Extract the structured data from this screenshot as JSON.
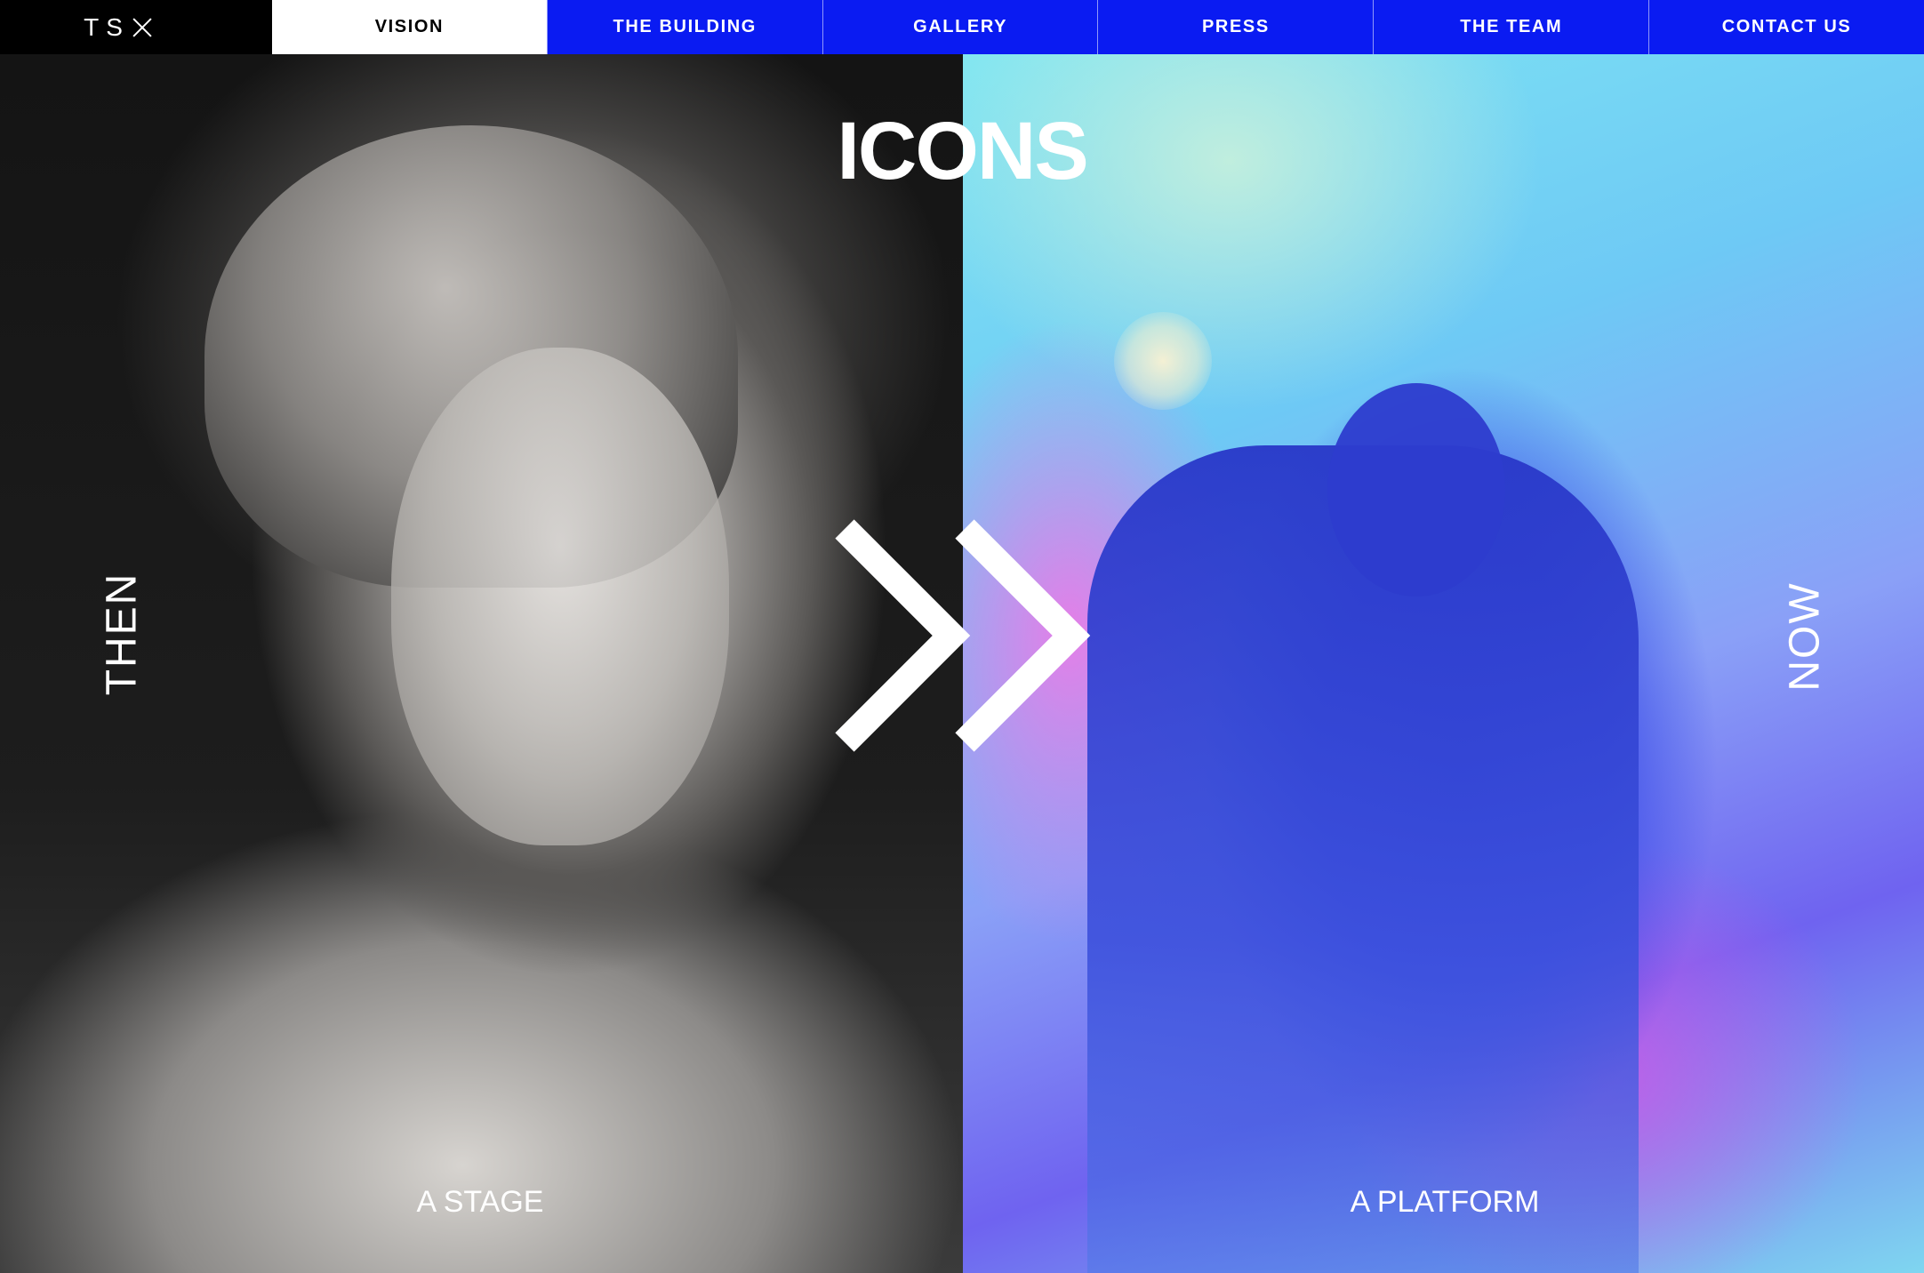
{
  "brand": {
    "logo_text": "TS"
  },
  "nav": {
    "items": [
      {
        "label": "VISION",
        "active": true
      },
      {
        "label": "THE BUILDING",
        "active": false
      },
      {
        "label": "GALLERY",
        "active": false
      },
      {
        "label": "PRESS",
        "active": false
      },
      {
        "label": "THE TEAM",
        "active": false
      },
      {
        "label": "CONTACT US",
        "active": false
      }
    ]
  },
  "hero": {
    "title": "ICONS",
    "left": {
      "side_label": "THEN",
      "caption": "A STAGE"
    },
    "right": {
      "side_label": "NOW",
      "caption": "A PLATFORM"
    },
    "divider_icon": "double-chevron-right-icon"
  },
  "colors": {
    "nav_blue": "#0a1bf2",
    "nav_active_bg": "#ffffff",
    "logo_bg": "#000000"
  }
}
